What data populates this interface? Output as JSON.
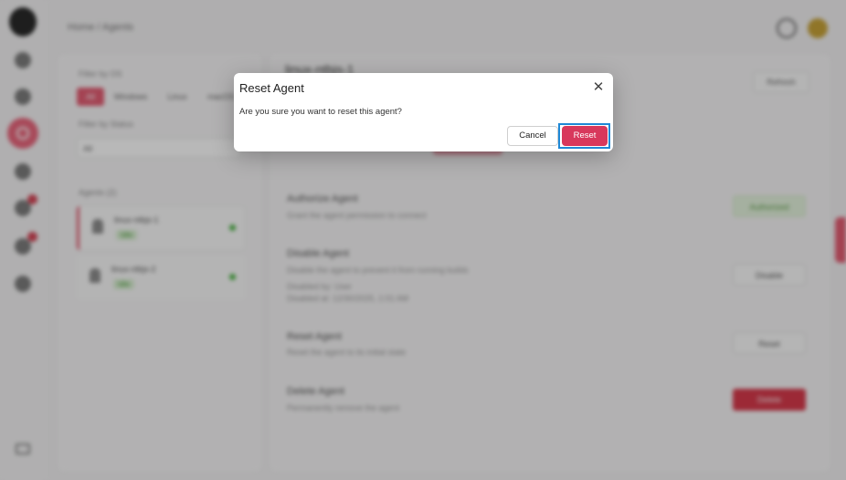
{
  "background": {
    "breadcrumb": "Home / Agents",
    "filter_os_label": "Filter by OS",
    "os_tabs": [
      "All",
      "Windows",
      "Linux",
      "macOS"
    ],
    "filter_status_label": "Filter by Status",
    "status_value": "All",
    "agents_label": "Agents (2)",
    "agents": [
      {
        "name": "linux-ntbjs-1",
        "status": "Idle"
      },
      {
        "name": "linux-ntbjs-2",
        "status": "Idle"
      }
    ],
    "detail_title": "linux-ntbjs-1",
    "detail_top_button": "Refresh",
    "actions": [
      {
        "title": "Authorize Agent",
        "desc": "Grant the agent permission to connect",
        "button": "Authorized"
      },
      {
        "title": "Disable Agent",
        "desc": "Disable the agent to prevent it from running builds",
        "button": "Disable"
      },
      {
        "title": "Reset Agent",
        "desc": "Reset the agent to its initial state",
        "button": "Reset"
      },
      {
        "title": "Delete Agent",
        "desc": "Permanently remove the agent",
        "button": "Delete"
      }
    ],
    "disable_meta": [
      "Disabled by: User",
      "Disabled at: 12/30/2025, 1:01 AM"
    ]
  },
  "dialog": {
    "title": "Reset Agent",
    "message": "Are you sure you want to reset this agent?",
    "cancel_label": "Cancel",
    "confirm_label": "Reset",
    "close_glyph": "✕"
  },
  "colors": {
    "accent": "#e35d73",
    "reset_button": "#d8385c",
    "focus_ring": "#1e88d6",
    "danger": "#d83a4c"
  }
}
